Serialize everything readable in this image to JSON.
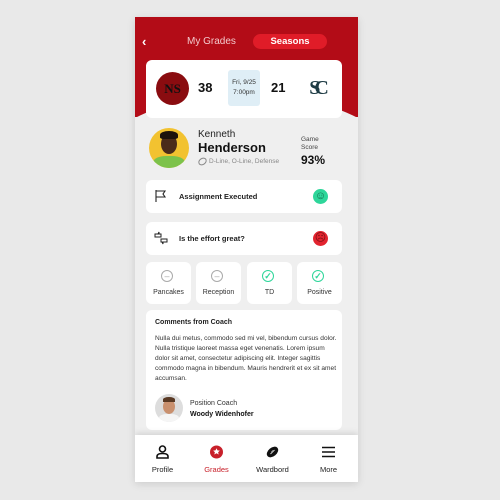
{
  "header": {
    "back_icon": "chevron-left-icon",
    "tabs": [
      {
        "label": "My Grades",
        "active": false
      },
      {
        "label": "Seasons",
        "active": true
      }
    ],
    "colors": {
      "primary": "#b30c17",
      "active_tab": "#e01c28"
    }
  },
  "game": {
    "home_team_logo": "NS",
    "home_score": "38",
    "date": "Fri, 9/25",
    "time": "7:00pm",
    "away_score": "21",
    "away_team_logo": "SC"
  },
  "player": {
    "first_name": "Kenneth",
    "last_name": "Henderson",
    "positions": "D-Line, O-Line, Defense",
    "game_score_label_1": "Game",
    "game_score_label_2": "Score",
    "game_score": "93%"
  },
  "ratings": [
    {
      "icon": "flag-icon",
      "label": "Assignment Executed",
      "status": "happy",
      "color": "#2ed69a"
    },
    {
      "icon": "thumbs-up-down-icon",
      "label": "Is the effort great?",
      "status": "sad",
      "color": "#e2242f"
    }
  ],
  "stats": [
    {
      "label": "Pancakes",
      "status": "neutral"
    },
    {
      "label": "Reception",
      "status": "neutral"
    },
    {
      "label": "TD",
      "status": "checked"
    },
    {
      "label": "Positive",
      "status": "checked"
    }
  ],
  "comments": {
    "title": "Comments from Coach",
    "body": "Nulla dui metus, commodo sed mi vel, bibendum cursus dolor. Nulla tristique laoreet massa eget venenatis.  Lorem ipsum dolor sit amet, consectetur adipiscing elit. Integer sagittis commodo magna in bibendum. Mauris hendrerit et ex sit amet accumsan.",
    "coach_role": "Position Coach",
    "coach_name": "Woody Widenhofer"
  },
  "nav": [
    {
      "label": "Profile",
      "icon": "person-icon",
      "active": false
    },
    {
      "label": "Grades",
      "icon": "star-badge-icon",
      "active": true
    },
    {
      "label": "Wardbord",
      "icon": "football-icon",
      "active": false
    },
    {
      "label": "More",
      "icon": "menu-icon",
      "active": false
    }
  ]
}
